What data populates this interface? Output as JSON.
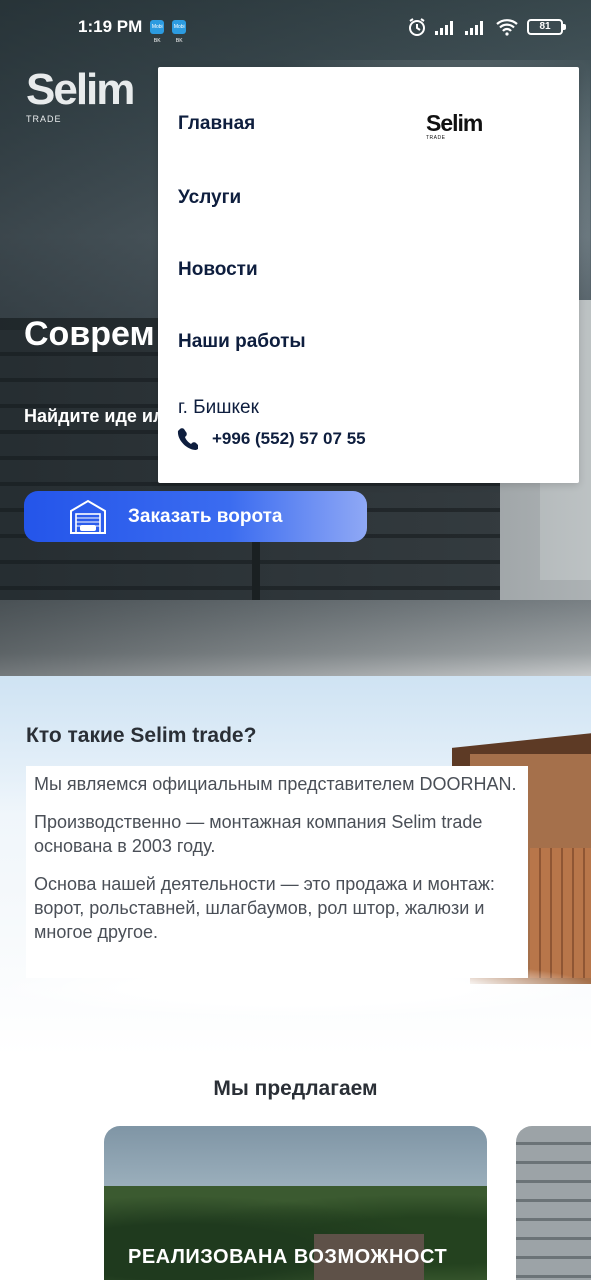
{
  "status_bar": {
    "time": "1:19 PM",
    "app_icon_1": "Mobi BK",
    "app_icon_2": "Mobi BK",
    "battery": "81"
  },
  "hero": {
    "logo_name": "Selim",
    "logo_sub": "TRADE",
    "title": "Соврем защита",
    "subtitle": "Найдите иде или предоста",
    "order_button": "Заказать ворота"
  },
  "menu": {
    "items": [
      {
        "label": "Главная"
      },
      {
        "label": "Услуги"
      },
      {
        "label": "Новости"
      },
      {
        "label": "Наши работы"
      }
    ],
    "logo_name": "Selim",
    "logo_sub": "TRADE",
    "city": "г. Бишкек",
    "phone": "+996 (552) 57 07 55"
  },
  "about": {
    "title": "Кто такие Selim trade?",
    "paragraphs": [
      "Мы являемся официальным представителем DOORHAN.",
      "Производственно — монтажная компания Selim trade основана в 2003 году.",
      "Основа нашей деятельности — это продажа и монтаж: ворот, рольставней, шлагбаумов, рол штор, жалюзи и многое другое."
    ]
  },
  "offer": {
    "title": "Мы предлагаем",
    "card_label": "РЕАЛИЗОВАНА ВОЗМОЖНОСТ"
  },
  "colors": {
    "accent": "#2455ea",
    "menu_text": "#0e1e3e"
  }
}
